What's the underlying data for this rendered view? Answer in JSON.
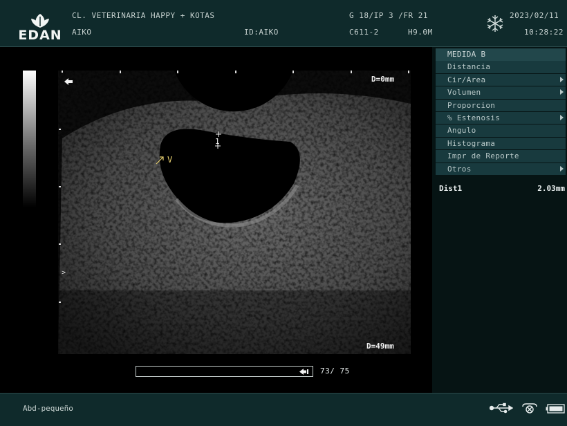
{
  "header": {
    "logo_text": "EDAN",
    "clinic": "CL. VETERINARIA HAPPY + KOTAS",
    "patient": "AIKO",
    "patient_id": "ID:AIKO",
    "params": "G 18/IP 3 /FR 21",
    "probe": "C611-2",
    "frequency": "H9.0M",
    "date": "2023/02/11",
    "time": "10:28:22",
    "freeze_icon": "snowflake-icon"
  },
  "image": {
    "depth_top": "D=0mm",
    "depth_bottom": "D=49mm",
    "caliper_label": "1",
    "annotation": "V",
    "focus_marker": ">"
  },
  "menu": {
    "title": "MEDIDA B",
    "items": [
      {
        "label": "Distancia",
        "has_submenu": false
      },
      {
        "label": "Cir/Area",
        "has_submenu": true
      },
      {
        "label": "Volumen",
        "has_submenu": true
      },
      {
        "label": "Proporcion",
        "has_submenu": false
      },
      {
        "label": "% Estenosis",
        "has_submenu": true
      },
      {
        "label": "Angulo",
        "has_submenu": false
      },
      {
        "label": "Histograma",
        "has_submenu": false
      },
      {
        "label": "Impr de Reporte",
        "has_submenu": false
      },
      {
        "label": "Otros",
        "has_submenu": true
      }
    ]
  },
  "measurement": {
    "label": "Dist1",
    "value": "2.03mm"
  },
  "cine": {
    "counter": "73/ 75",
    "progress": 0.973
  },
  "footer": {
    "preset": "Abd-pequeño",
    "status_icons": [
      "usb-icon",
      "printer-icon",
      "battery-icon"
    ]
  },
  "colors": {
    "panel_bg": "#0f2a2b",
    "menu_item_bg": "#183a3e",
    "annotation": "#e8d070"
  }
}
